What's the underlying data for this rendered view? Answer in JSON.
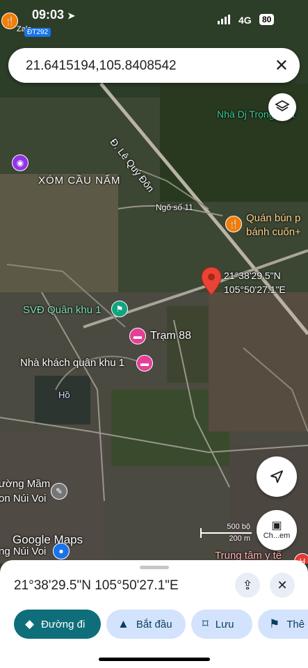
{
  "status_bar": {
    "time": "09:03",
    "network": "4G",
    "battery": "80",
    "route_tag": "ĐT292",
    "back_label": "Zalo"
  },
  "search": {
    "query": "21.6415194,105.8408542"
  },
  "map": {
    "labels": {
      "road_le_quy_don": "Đ. Lê Quý Đôn",
      "nha_dj": "Nhà Dj Trọng Hua",
      "xom_cau_nam": "XÓM CẦU NẤM",
      "ngo_11": "Ngõ số 11",
      "quan_bun_1": "Quán bún p",
      "quan_bun_2": "bánh cuốn+",
      "svd": "SVĐ Quân khu 1",
      "tram88": "Trạm 88",
      "nha_khach": "Nhà khách quân khu 1",
      "ho": "Hồ",
      "mam_non_1": "ường Mầm",
      "mam_non_2": "on Núi Voi",
      "nui_voi": "ng Núi Voi",
      "trung_tam": "Trung tâm y tế",
      "google_maps": "Google Maps"
    },
    "pin": {
      "lat_dms": "21°38'29.5\"N",
      "lng_dms": "105°50'27.1\"E"
    },
    "scale": {
      "ft": "500 bộ",
      "m": "200 m"
    },
    "camera_chip": "Ch...em",
    "icons": [
      "layers-icon",
      "navigation-arrow-icon",
      "camera-icon",
      "food-icon",
      "stadium-icon",
      "hotel-icon",
      "school-icon",
      "location-pin-icon"
    ]
  },
  "place_sheet": {
    "coords": "21°38'29.5\"N 105°50'27.1\"E",
    "actions": [
      {
        "label": "Đường đi",
        "icon": "directions-icon"
      },
      {
        "label": "Bắt đầu",
        "icon": "navigate-icon"
      },
      {
        "label": "Lưu",
        "icon": "bookmark-icon"
      },
      {
        "label": "Thê",
        "icon": "flag-icon"
      }
    ]
  },
  "colors": {
    "primary": "#0b57d0",
    "directions_btn": "#0e6e7a",
    "chip_bg": "#d3e3fd",
    "pin": "#ea4335"
  }
}
